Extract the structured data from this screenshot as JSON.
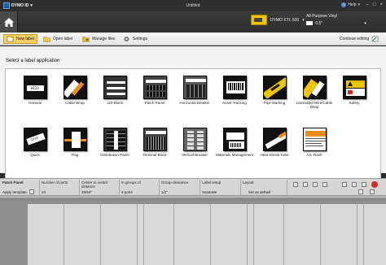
{
  "window": {
    "app_name": "DYMO ID",
    "doc_title": "Untitled",
    "help": "Help",
    "min": "–",
    "max": "□",
    "close": "×"
  },
  "header": {
    "printer_name": "DYMO XTL 500",
    "label_type": "All-Purpose Vinyl",
    "label_size": "0.5\""
  },
  "toolbar": {
    "new_label": "New label",
    "open_label": "Open label",
    "manage_files": "Manage files",
    "settings": "Settings",
    "continue_editing": "Continue editing"
  },
  "main": {
    "select_title": "Select a label application",
    "applications": [
      {
        "label": "General",
        "icon": "general-label-icon"
      },
      {
        "label": "Cable Wrap",
        "icon": "cable-wrap-icon"
      },
      {
        "label": "110-Block",
        "icon": "110-block-icon"
      },
      {
        "label": "Patch Panel",
        "icon": "patch-panel-icon"
      },
      {
        "label": "Horizontal Breaker",
        "icon": "horizontal-breaker-icon"
      },
      {
        "label": "Asset Tracking",
        "icon": "asset-tracking-icon"
      },
      {
        "label": "Pipe Marking",
        "icon": "pipe-marking-icon"
      },
      {
        "label": "Laminated Wire/Cable Wrap",
        "icon": "laminated-wrap-icon"
      },
      {
        "label": "Safety",
        "icon": "safety-icon"
      },
      {
        "label": "Quick",
        "icon": "quick-icon"
      },
      {
        "label": "Flag",
        "icon": "flag-icon"
      },
      {
        "label": "Distribution Panel",
        "icon": "distribution-panel-icon"
      },
      {
        "label": "Terminal Block",
        "icon": "terminal-block-icon"
      },
      {
        "label": "Vertical Breaker",
        "icon": "vertical-breaker-icon"
      },
      {
        "label": "Materials Management",
        "icon": "materials-management-icon"
      },
      {
        "label": "Heat-Shrink Tube",
        "icon": "heat-shrink-tube-icon"
      },
      {
        "label": "Arc Flash",
        "icon": "arc-flash-icon"
      }
    ]
  },
  "properties": {
    "section": "Patch Panel",
    "apply_template": "Apply template",
    "number_of_ports_label": "Number of ports",
    "number_of_ports": "24",
    "center_distance_label": "Center to center distance",
    "center_distance": "25/64\"",
    "groups_label": "In groups of",
    "groups": "6 ports",
    "group_clearance_label": "Group clearance",
    "group_clearance": "1/2\"",
    "label_setup_label": "Label setup",
    "label_setup": "Separate",
    "layout_label": "Layout",
    "layout": "Set as default"
  },
  "colors": {
    "accent": "#f4cf5e",
    "title_bar": "#2e2e2e",
    "label_yellow": "#f1c400"
  }
}
